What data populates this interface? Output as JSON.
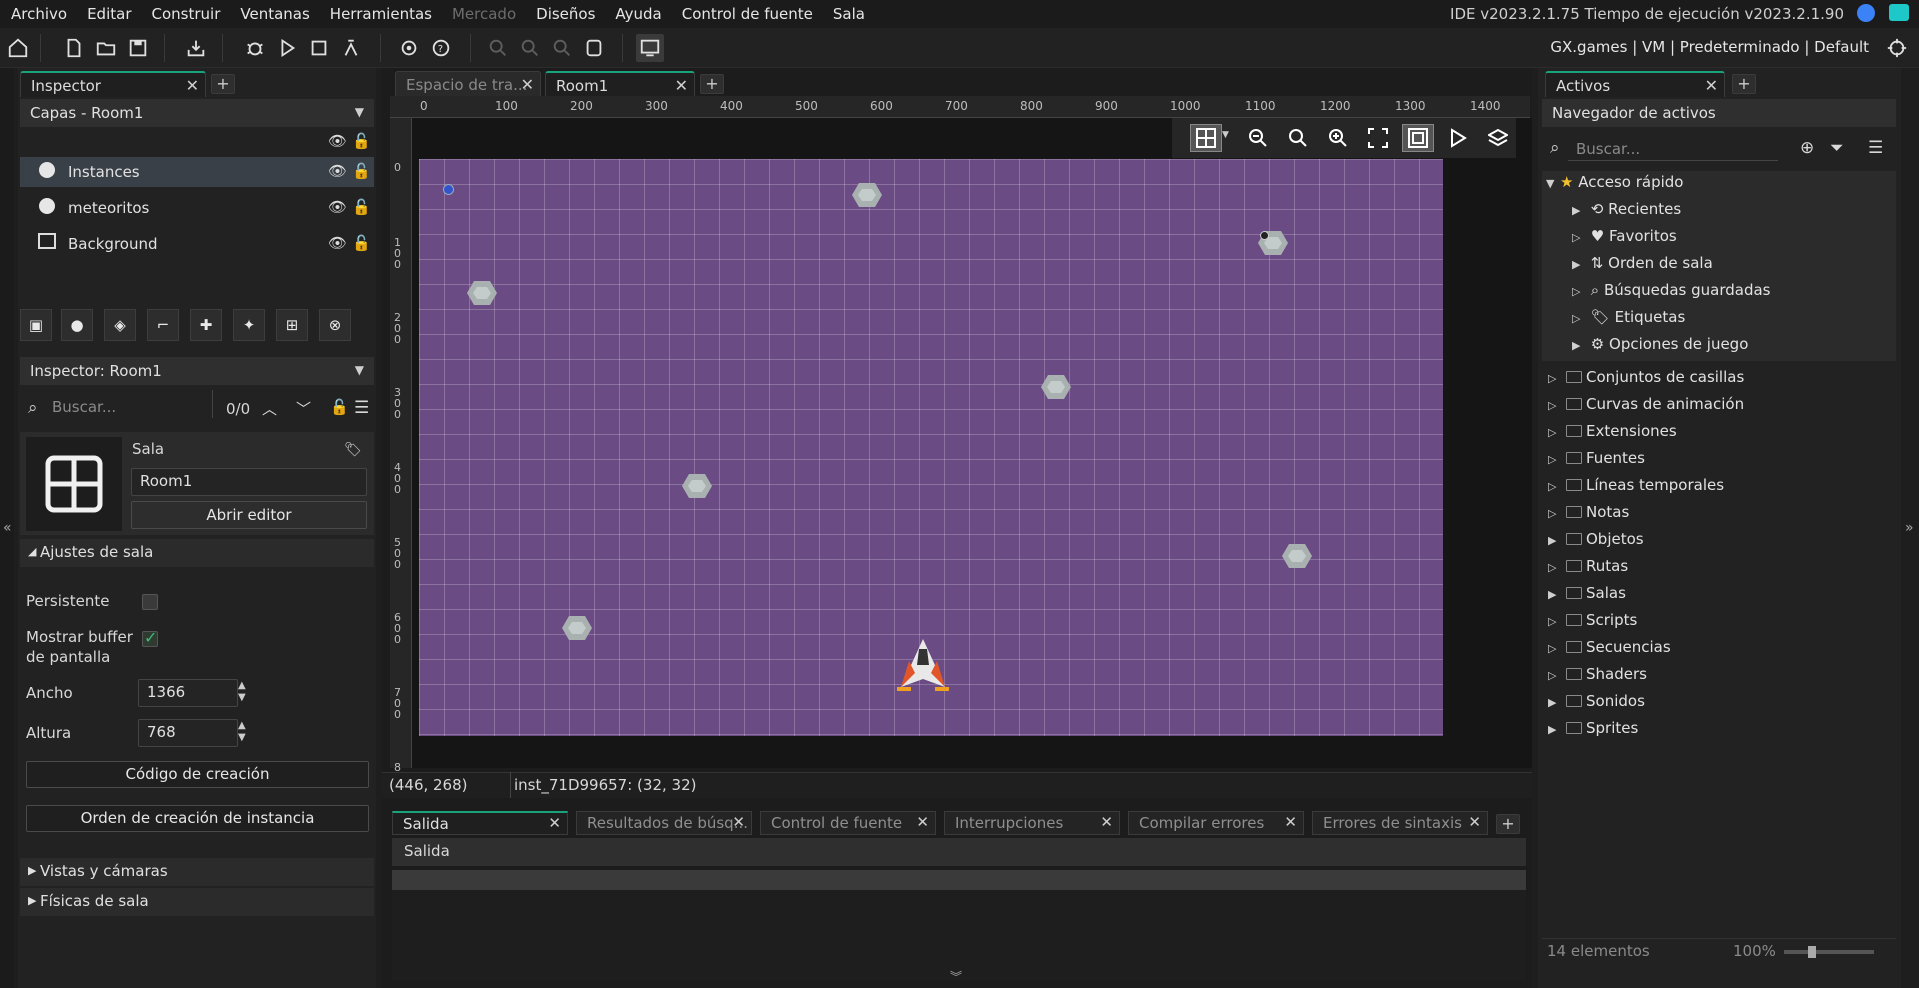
{
  "menu": {
    "items": [
      "Archivo",
      "Editar",
      "Construir",
      "Ventanas",
      "Herramientas",
      "Mercado",
      "Diseños",
      "Ayuda",
      "Control de fuente",
      "Sala"
    ],
    "disabled": [
      "Mercado"
    ],
    "version": "IDE v2023.2.1.75  Tiempo de ejecución v2023.2.1.90"
  },
  "toolbar": {
    "target": "GX.games | VM | Predeterminado | Default"
  },
  "left": {
    "tab": "Inspector",
    "layers_header": "Capas - Room1",
    "layers": [
      {
        "name": "Instances",
        "icon": "instance-layer-icon"
      },
      {
        "name": "meteoritos",
        "icon": "instance-layer-icon"
      },
      {
        "name": "Background",
        "icon": "background-layer-icon"
      }
    ],
    "inspector_header": "Inspector: Room1",
    "search_placeholder": "Buscar...",
    "search_count": "0/0",
    "resource_type": "Sala",
    "room_name": "Room1",
    "open_editor": "Abrir editor",
    "room_settings": "Ajustes de sala",
    "persistent_label": "Persistente",
    "show_buffer_label1": "Mostrar buffer",
    "show_buffer_label2": "de pantalla",
    "width_label": "Ancho",
    "width_value": "1366",
    "height_label": "Altura",
    "height_value": "768",
    "creation_code": "Código de creación",
    "instance_order": "Orden de creación de instancia",
    "views": "Vistas y cámaras",
    "physics": "Físicas de sala"
  },
  "center": {
    "tabs": [
      "Espacio de tra...",
      "Room1"
    ],
    "ruler_x": [
      "0",
      "100",
      "200",
      "300",
      "400",
      "500",
      "600",
      "700",
      "800",
      "900",
      "1000",
      "1100",
      "1200",
      "1300",
      "1400"
    ],
    "ruler_y": [
      "0",
      "1\n0\n0",
      "2\n0\n0",
      "3\n0\n0",
      "4\n0\n0",
      "5\n0\n0",
      "6\n0\n0",
      "7\n0\n0",
      "8"
    ],
    "cursor_pos": "(446, 268)",
    "instance_info": "inst_71D99657: (32, 32)",
    "output_tabs": [
      "Salida",
      "Resultados de búsq...",
      "Control de fuente",
      "Interrupciones",
      "Compilar errores",
      "Errores de sintaxis"
    ],
    "output_title": "Salida"
  },
  "right": {
    "tab": "Activos",
    "browser_title": "Navegador de activos",
    "search_placeholder": "Buscar...",
    "quick_access": "Acceso rápido",
    "quick_items": [
      "Recientes",
      "Favoritos",
      "Orden de sala",
      "Búsquedas guardadas",
      "Etiquetas",
      "Opciones de juego"
    ],
    "folders": [
      "Conjuntos de casillas",
      "Curvas de animación",
      "Extensiones",
      "Fuentes",
      "Líneas temporales",
      "Notas",
      "Objetos",
      "Rutas",
      "Salas",
      "Scripts",
      "Secuencias",
      "Shaders",
      "Sonidos",
      "Sprites"
    ],
    "count": "14 elementos",
    "zoom": "100%"
  },
  "colors": {
    "accent": "#19a37a",
    "room_bg": "#6b4b84"
  }
}
